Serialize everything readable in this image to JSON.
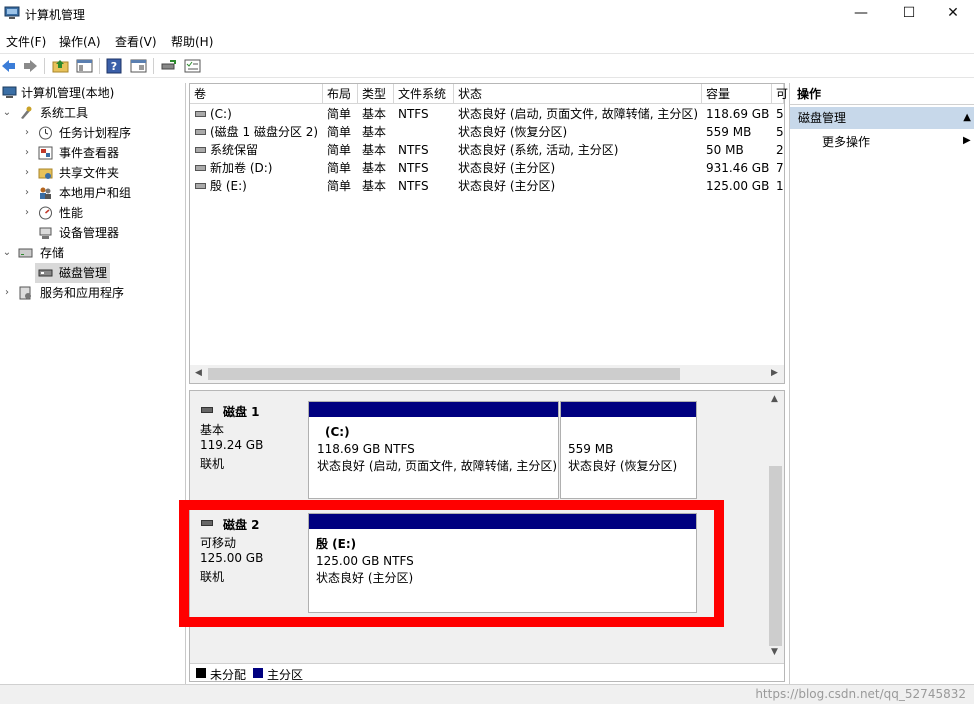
{
  "window": {
    "title": "计算机管理",
    "minimize": "—",
    "maximize": "☐",
    "close": "✕"
  },
  "menu": [
    "文件(F)",
    "操作(A)",
    "查看(V)",
    "帮助(H)"
  ],
  "tree": {
    "root": "计算机管理(本地)",
    "system_tools": "系统工具",
    "task_scheduler": "任务计划程序",
    "event_viewer": "事件查看器",
    "shared_folders": "共享文件夹",
    "local_users": "本地用户和组",
    "performance": "性能",
    "device_manager": "设备管理器",
    "storage": "存储",
    "disk_management": "磁盘管理",
    "services": "服务和应用程序"
  },
  "volume_list": {
    "headers": [
      "卷",
      "布局",
      "类型",
      "文件系统",
      "状态",
      "容量",
      "可"
    ],
    "rows": [
      {
        "name": "(C:)",
        "layout": "简单",
        "type": "基本",
        "fs": "NTFS",
        "status": "状态良好 (启动, 页面文件, 故障转储, 主分区)",
        "capacity": "118.69 GB",
        "free": "5"
      },
      {
        "name": "(磁盘 1 磁盘分区 2)",
        "layout": "简单",
        "type": "基本",
        "fs": "",
        "status": "状态良好 (恢复分区)",
        "capacity": "559 MB",
        "free": "5"
      },
      {
        "name": "系统保留",
        "layout": "简单",
        "type": "基本",
        "fs": "NTFS",
        "status": "状态良好 (系统, 活动, 主分区)",
        "capacity": "50 MB",
        "free": "2"
      },
      {
        "name": "新加卷 (D:)",
        "layout": "简单",
        "type": "基本",
        "fs": "NTFS",
        "status": "状态良好 (主分区)",
        "capacity": "931.46 GB",
        "free": "7"
      },
      {
        "name": "殷 (E:)",
        "layout": "简单",
        "type": "基本",
        "fs": "NTFS",
        "status": "状态良好 (主分区)",
        "capacity": "125.00 GB",
        "free": "1"
      }
    ]
  },
  "disks": [
    {
      "name": "磁盘 1",
      "kind": "基本",
      "size": "119.24 GB",
      "state": "联机",
      "partitions": [
        {
          "title": "(C:)",
          "detail": "118.69 GB NTFS",
          "status": "状态良好 (启动, 页面文件, 故障转储, 主分区)"
        },
        {
          "title": "",
          "detail": "559 MB",
          "status": "状态良好 (恢复分区)"
        }
      ]
    },
    {
      "name": "磁盘 2",
      "kind": "可移动",
      "size": "125.00 GB",
      "state": "联机",
      "partitions": [
        {
          "title": "殷  (E:)",
          "detail": "125.00 GB NTFS",
          "status": "状态良好 (主分区)"
        }
      ]
    }
  ],
  "legend": {
    "unallocated": "未分配",
    "primary": "主分区",
    "unallocated_color": "#000000",
    "primary_color": "#000080"
  },
  "actions": {
    "header": "操作",
    "section": "磁盘管理",
    "more": "更多操作"
  },
  "watermark": "https://blog.csdn.net/qq_52745832",
  "colors": {
    "highlight": "#ff0000",
    "partition_bar": "#000080",
    "selected_section": "#c7d8ea"
  }
}
